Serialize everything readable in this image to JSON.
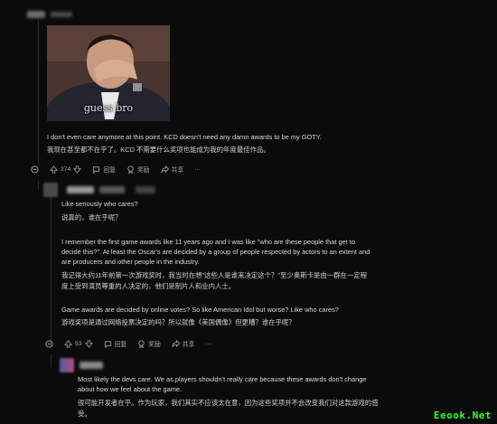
{
  "comment1": {
    "image_caption": "guess bro",
    "text_en": "I don't even care anymore at this point. KCD doesn't need any damn awards to be my GOTY.",
    "text_cn": "我现在甚至都不在乎了。KCD 不需要什么奖项也能成为我的年度最佳作品。",
    "votes": "274",
    "reply_label": "回复",
    "award_label": "奖励",
    "share_label": "共享"
  },
  "comment2": {
    "p1_en": "Like seriously who cares?",
    "p1_cn": "说真的，谁在乎呢？",
    "p2_en_1": "I remember the first game awards like 11 years ago and I was like \"who are these people that get to",
    "p2_en_2": "decide this?\". At least the Oscar's are decided by a group of people respected by actors to an extent and",
    "p2_en_3": "are producers and other people in the industry.",
    "p2_cn_1": "我记得大约11年前第一次游戏奖时，我当时在想\"这些人是谁来决定这个？\"至少奥斯卡是由一群在一定程",
    "p2_cn_2": "度上受到演员尊重的人决定的，他们是制片人和业内人士。",
    "p3_en": "Game awards are decided by online votes? So like American Idol but worse? Like who cares?",
    "p3_cn": "游戏奖项是通过网络投票决定的吗？所以就像《美国偶像》但更糟？谁在乎呢？",
    "votes": "53",
    "reply_label": "回复",
    "award_label": "奖励",
    "share_label": "共享"
  },
  "comment3": {
    "p1_en_1": "Most likely the devs care. We as players shouldn't really care because these awards don't change",
    "p1_en_2": "about how we feel about the game.",
    "p1_cn_1": "很可能开发者在乎。作为玩家，我们其实不应该太在意，因为这些奖项并不会改变我们对这款游戏的感",
    "p1_cn_2": "受。"
  },
  "watermark": "Eeook.Net",
  "colors": {
    "background": "#0b0b0b",
    "text": "#d7dadc",
    "muted": "#a7aaac",
    "watermark": "#2cff2c"
  },
  "icons": [
    "collapse-icon",
    "upvote-icon",
    "downvote-icon",
    "reply-icon",
    "award-icon",
    "share-icon",
    "more-icon"
  ]
}
